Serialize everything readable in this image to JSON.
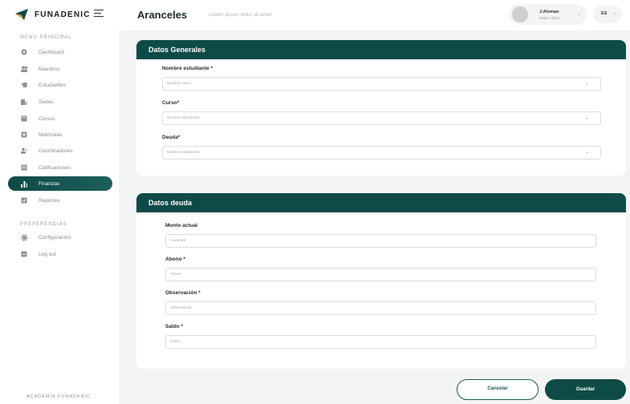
{
  "brand": {
    "name": "FUNADENIC",
    "footer": "ACADEMIA FUNADENIC"
  },
  "sidebar": {
    "main_section": "MENU PRINCIPAL",
    "items": [
      {
        "label": "Dashboard",
        "icon": "dashboard-icon"
      },
      {
        "label": "Maestros",
        "icon": "users-icon"
      },
      {
        "label": "Estudiantes",
        "icon": "graduation-cap-icon"
      },
      {
        "label": "Sedes",
        "icon": "building-icon"
      },
      {
        "label": "Cursos",
        "icon": "book-icon"
      },
      {
        "label": "Matriculas",
        "icon": "plus-square-icon"
      },
      {
        "label": "Coordinadores",
        "icon": "user-plus-icon"
      },
      {
        "label": "Calificaciones",
        "icon": "grades-icon"
      },
      {
        "label": "Finanzas",
        "icon": "bar-chart-icon",
        "active": true
      },
      {
        "label": "Reportes",
        "icon": "report-icon"
      }
    ],
    "pref_section": "PREFERENCIAS",
    "pref_items": [
      {
        "label": "Configuración",
        "icon": "gear-icon"
      },
      {
        "label": "Log out",
        "icon": "logout-icon"
      }
    ]
  },
  "header": {
    "title": "Aranceles",
    "subtitle": "Lorem ipsum dolor sit amet",
    "user_name": "J.Aleman",
    "user_role": "Super Admin",
    "language": "ES"
  },
  "general": {
    "title": "Datos Generales",
    "fields": [
      {
        "label": "Nombre estudiante *",
        "placeholder": "Nombre curso"
      },
      {
        "label": "Curso*",
        "placeholder": "Nombre estudiante"
      },
      {
        "label": "Deuda*",
        "placeholder": "Nombre estudiante"
      }
    ]
  },
  "debt": {
    "title": "Datos deuda",
    "fields": [
      {
        "label": "Monto actual",
        "placeholder": "Cantidad"
      },
      {
        "label": "Abono *",
        "placeholder": "Abono"
      },
      {
        "label": "Observación *",
        "placeholder": "Observación"
      },
      {
        "label": "Saldo *",
        "placeholder": "Saldo"
      }
    ]
  },
  "actions": {
    "cancel": "Cancelar",
    "save": "Guardar"
  },
  "colors": {
    "primary": "#0e4b47",
    "background": "#f3f4f5"
  }
}
